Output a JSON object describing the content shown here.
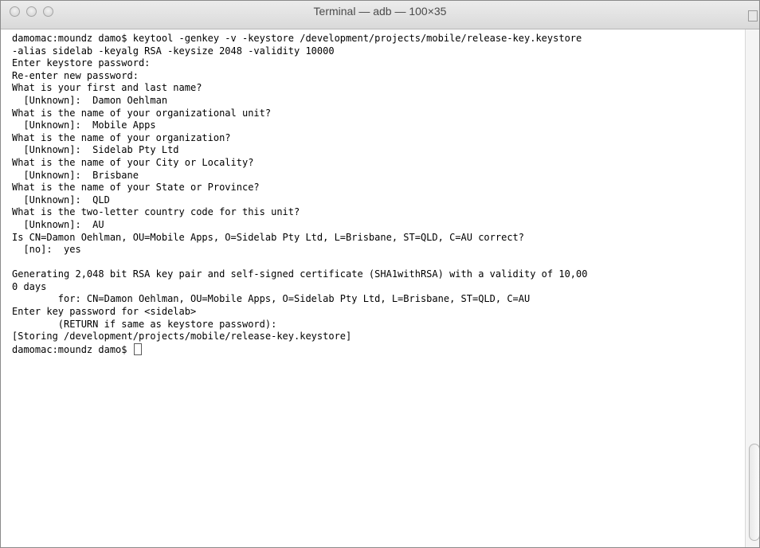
{
  "window": {
    "title": "Terminal — adb — 100×35"
  },
  "traffic_lights": {
    "close_icon": "close-icon",
    "minimize_icon": "minimize-icon",
    "zoom_icon": "zoom-icon"
  },
  "terminal": {
    "lines": [
      "damomac:moundz damo$ keytool -genkey -v -keystore /development/projects/mobile/release-key.keystore",
      "-alias sidelab -keyalg RSA -keysize 2048 -validity 10000",
      "Enter keystore password:",
      "Re-enter new password:",
      "What is your first and last name?",
      "  [Unknown]:  Damon Oehlman",
      "What is the name of your organizational unit?",
      "  [Unknown]:  Mobile Apps",
      "What is the name of your organization?",
      "  [Unknown]:  Sidelab Pty Ltd",
      "What is the name of your City or Locality?",
      "  [Unknown]:  Brisbane",
      "What is the name of your State or Province?",
      "  [Unknown]:  QLD",
      "What is the two-letter country code for this unit?",
      "  [Unknown]:  AU",
      "Is CN=Damon Oehlman, OU=Mobile Apps, O=Sidelab Pty Ltd, L=Brisbane, ST=QLD, C=AU correct?",
      "  [no]:  yes",
      "",
      "Generating 2,048 bit RSA key pair and self-signed certificate (SHA1withRSA) with a validity of 10,00",
      "0 days",
      "        for: CN=Damon Oehlman, OU=Mobile Apps, O=Sidelab Pty Ltd, L=Brisbane, ST=QLD, C=AU",
      "Enter key password for <sidelab>",
      "        (RETURN if same as keystore password):",
      "[Storing /development/projects/mobile/release-key.keystore]"
    ],
    "prompt": "damomac:moundz damo$ "
  }
}
